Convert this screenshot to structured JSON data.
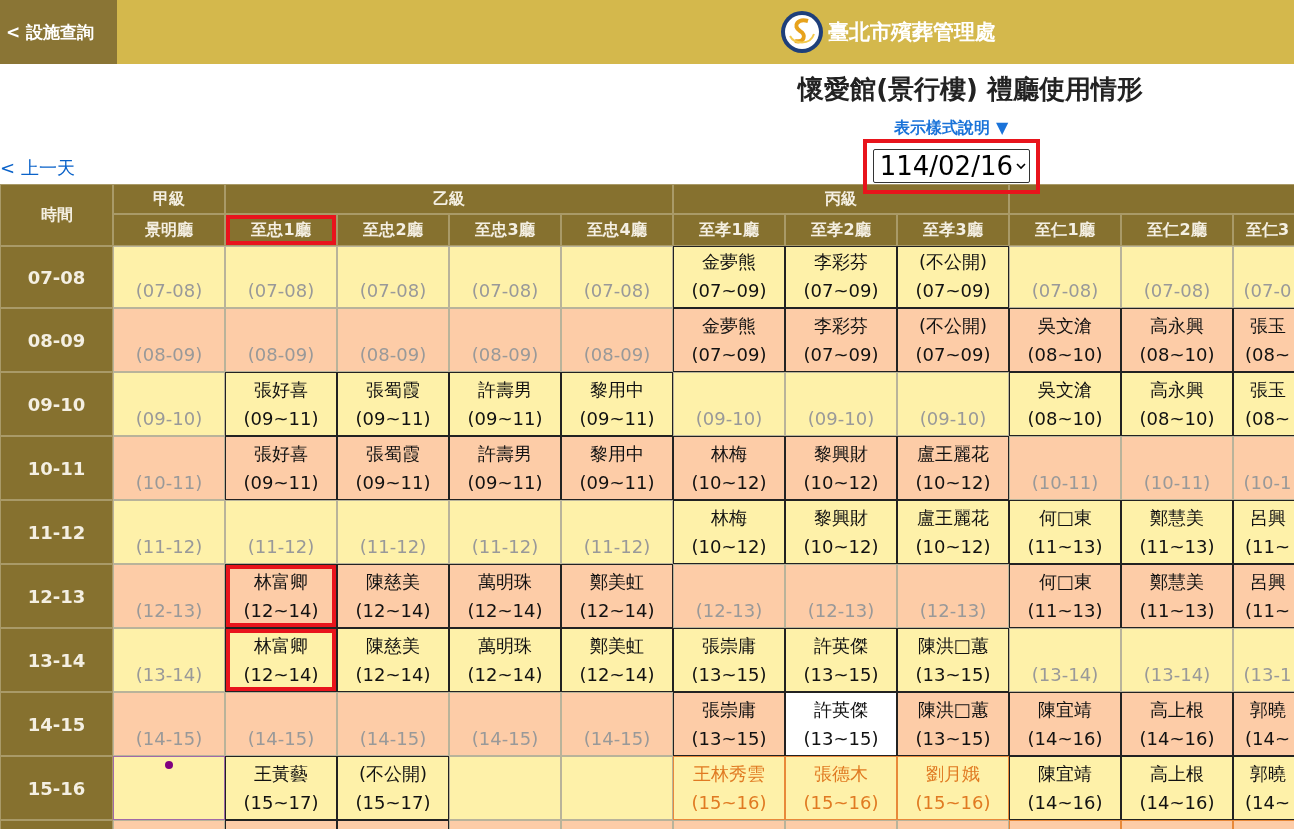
{
  "top_bar": {
    "back_button": "< 設施查詢",
    "agency": "臺北市殯葬管理處"
  },
  "title": "懷愛館(景行樓) 禮廳使用情形",
  "legend_link": "表示樣式說明 ▼",
  "date_select": {
    "value": "114/02/16",
    "highlighted": true
  },
  "prev_day_link": "< 上一天",
  "table": {
    "time_header": "時間",
    "groups": [
      {
        "label": "甲級",
        "columns": [
          {
            "label": "景明廳"
          }
        ]
      },
      {
        "label": "乙級",
        "columns": [
          {
            "label": "至忠1廳",
            "highlighted": true
          },
          {
            "label": "至忠2廳"
          },
          {
            "label": "至忠3廳"
          },
          {
            "label": "至忠4廳"
          }
        ]
      },
      {
        "label": "丙級",
        "columns": [
          {
            "label": "至孝1廳"
          },
          {
            "label": "至孝2廳"
          },
          {
            "label": "至孝3廳"
          }
        ]
      },
      {
        "columns": [
          {
            "label": "至仁1廳"
          },
          {
            "label": "至仁2廳"
          },
          {
            "label": "至仁3",
            "cut": true
          }
        ]
      }
    ],
    "rows": [
      {
        "time": "07-08",
        "cells": [
          {
            "kind": "free",
            "text": "(07-08)"
          },
          {
            "kind": "free",
            "text": "(07-08)"
          },
          {
            "kind": "free",
            "text": "(07-08)"
          },
          {
            "kind": "free",
            "text": "(07-08)"
          },
          {
            "kind": "free",
            "text": "(07-08)"
          },
          {
            "kind": "booked",
            "name": "金夢熊",
            "time": "(07~09)"
          },
          {
            "kind": "booked",
            "name": "李彩芬",
            "time": "(07~09)"
          },
          {
            "kind": "booked",
            "name": "(不公開)",
            "time": "(07~09)"
          },
          {
            "kind": "free",
            "text": "(07-08)"
          },
          {
            "kind": "free",
            "text": "(07-08)"
          },
          {
            "kind": "free",
            "text": "(07-0"
          }
        ]
      },
      {
        "time": "08-09",
        "cells": [
          {
            "kind": "free",
            "text": "(08-09)"
          },
          {
            "kind": "free",
            "text": "(08-09)"
          },
          {
            "kind": "free",
            "text": "(08-09)"
          },
          {
            "kind": "free",
            "text": "(08-09)"
          },
          {
            "kind": "free",
            "text": "(08-09)"
          },
          {
            "kind": "booked",
            "name": "金夢熊",
            "time": "(07~09)"
          },
          {
            "kind": "booked",
            "name": "李彩芬",
            "time": "(07~09)"
          },
          {
            "kind": "booked",
            "name": "(不公開)",
            "time": "(07~09)"
          },
          {
            "kind": "booked",
            "name": "吳文滄",
            "time": "(08~10)"
          },
          {
            "kind": "booked",
            "name": "高永興",
            "time": "(08~10)"
          },
          {
            "kind": "booked",
            "name": "張玉",
            "time": "(08~"
          }
        ]
      },
      {
        "time": "09-10",
        "cells": [
          {
            "kind": "free",
            "text": "(09-10)"
          },
          {
            "kind": "booked",
            "name": "張好喜",
            "time": "(09~11)"
          },
          {
            "kind": "booked",
            "name": "張蜀霞",
            "time": "(09~11)"
          },
          {
            "kind": "booked",
            "name": "許壽男",
            "time": "(09~11)"
          },
          {
            "kind": "booked",
            "name": "黎用中",
            "time": "(09~11)"
          },
          {
            "kind": "free",
            "text": "(09-10)"
          },
          {
            "kind": "free",
            "text": "(09-10)"
          },
          {
            "kind": "free",
            "text": "(09-10)"
          },
          {
            "kind": "booked",
            "name": "吳文滄",
            "time": "(08~10)"
          },
          {
            "kind": "booked",
            "name": "高永興",
            "time": "(08~10)"
          },
          {
            "kind": "booked",
            "name": "張玉",
            "time": "(08~"
          }
        ]
      },
      {
        "time": "10-11",
        "cells": [
          {
            "kind": "free",
            "text": "(10-11)"
          },
          {
            "kind": "booked",
            "name": "張好喜",
            "time": "(09~11)"
          },
          {
            "kind": "booked",
            "name": "張蜀霞",
            "time": "(09~11)"
          },
          {
            "kind": "booked",
            "name": "許壽男",
            "time": "(09~11)"
          },
          {
            "kind": "booked",
            "name": "黎用中",
            "time": "(09~11)"
          },
          {
            "kind": "booked",
            "name": "林梅",
            "time": "(10~12)"
          },
          {
            "kind": "booked",
            "name": "黎興財",
            "time": "(10~12)"
          },
          {
            "kind": "booked",
            "name": "盧王麗花",
            "time": "(10~12)"
          },
          {
            "kind": "free",
            "text": "(10-11)"
          },
          {
            "kind": "free",
            "text": "(10-11)"
          },
          {
            "kind": "free",
            "text": "(10-1"
          }
        ]
      },
      {
        "time": "11-12",
        "cells": [
          {
            "kind": "free",
            "text": "(11-12)"
          },
          {
            "kind": "free",
            "text": "(11-12)"
          },
          {
            "kind": "free",
            "text": "(11-12)"
          },
          {
            "kind": "free",
            "text": "(11-12)"
          },
          {
            "kind": "free",
            "text": "(11-12)"
          },
          {
            "kind": "booked",
            "name": "林梅",
            "time": "(10~12)"
          },
          {
            "kind": "booked",
            "name": "黎興財",
            "time": "(10~12)"
          },
          {
            "kind": "booked",
            "name": "盧王麗花",
            "time": "(10~12)"
          },
          {
            "kind": "booked",
            "name": "何□東",
            "time": "(11~13)"
          },
          {
            "kind": "booked",
            "name": "鄭慧美",
            "time": "(11~13)"
          },
          {
            "kind": "booked",
            "name": "呂興",
            "time": "(11~"
          }
        ]
      },
      {
        "time": "12-13",
        "cells": [
          {
            "kind": "free",
            "text": "(12-13)"
          },
          {
            "kind": "booked",
            "name": "林富卿",
            "time": "(12~14)",
            "highlighted": true
          },
          {
            "kind": "booked",
            "name": "陳慈美",
            "time": "(12~14)"
          },
          {
            "kind": "booked",
            "name": "萬明珠",
            "time": "(12~14)"
          },
          {
            "kind": "booked",
            "name": "鄭美虹",
            "time": "(12~14)"
          },
          {
            "kind": "free",
            "text": "(12-13)"
          },
          {
            "kind": "free",
            "text": "(12-13)"
          },
          {
            "kind": "free",
            "text": "(12-13)"
          },
          {
            "kind": "booked",
            "name": "何□東",
            "time": "(11~13)"
          },
          {
            "kind": "booked",
            "name": "鄭慧美",
            "time": "(11~13)"
          },
          {
            "kind": "booked",
            "name": "呂興",
            "time": "(11~"
          }
        ]
      },
      {
        "time": "13-14",
        "cells": [
          {
            "kind": "free",
            "text": "(13-14)"
          },
          {
            "kind": "booked",
            "name": "林富卿",
            "time": "(12~14)",
            "highlighted": true
          },
          {
            "kind": "booked",
            "name": "陳慈美",
            "time": "(12~14)"
          },
          {
            "kind": "booked",
            "name": "萬明珠",
            "time": "(12~14)"
          },
          {
            "kind": "booked",
            "name": "鄭美虹",
            "time": "(12~14)"
          },
          {
            "kind": "booked",
            "name": "張崇庸",
            "time": "(13~15)"
          },
          {
            "kind": "booked",
            "name": "許英傑",
            "time": "(13~15)"
          },
          {
            "kind": "booked",
            "name": "陳洪□蕙",
            "time": "(13~15)"
          },
          {
            "kind": "free",
            "text": "(13-14)"
          },
          {
            "kind": "free",
            "text": "(13-14)"
          },
          {
            "kind": "free",
            "text": "(13-1"
          }
        ]
      },
      {
        "time": "14-15",
        "cells": [
          {
            "kind": "free",
            "text": "(14-15)"
          },
          {
            "kind": "free",
            "text": "(14-15)"
          },
          {
            "kind": "free",
            "text": "(14-15)"
          },
          {
            "kind": "free",
            "text": "(14-15)"
          },
          {
            "kind": "free",
            "text": "(14-15)"
          },
          {
            "kind": "booked",
            "name": "張崇庸",
            "time": "(13~15)"
          },
          {
            "kind": "marked",
            "name": "許英傑",
            "time": "(13~15)"
          },
          {
            "kind": "booked",
            "name": "陳洪□蕙",
            "time": "(13~15)"
          },
          {
            "kind": "booked",
            "name": "陳宜靖",
            "time": "(14~16)"
          },
          {
            "kind": "booked",
            "name": "高上根",
            "time": "(14~16)"
          },
          {
            "kind": "booked",
            "name": "郭曉",
            "time": "(14~"
          }
        ]
      },
      {
        "time": "15-16",
        "cells": [
          {
            "kind": "dot",
            "color": "#800080"
          },
          {
            "kind": "booked",
            "name": "王黃藝",
            "time": "(15~17)"
          },
          {
            "kind": "booked",
            "name": "(不公開)",
            "time": "(15~17)"
          },
          {
            "kind": "empty"
          },
          {
            "kind": "empty"
          },
          {
            "kind": "tentative",
            "name": "王林秀雲",
            "time": "(15~16)"
          },
          {
            "kind": "tentative",
            "name": "張德木",
            "time": "(15~16)"
          },
          {
            "kind": "tentative",
            "name": "劉月娥",
            "time": "(15~16)"
          },
          {
            "kind": "booked",
            "name": "陳宜靖",
            "time": "(14~16)"
          },
          {
            "kind": "booked",
            "name": "高上根",
            "time": "(14~16)"
          },
          {
            "kind": "booked",
            "name": "郭曉",
            "time": "(14~"
          }
        ]
      },
      {
        "partial": true,
        "cells": [
          {
            "kind": "free"
          },
          {
            "kind": "booked"
          },
          {
            "kind": "booked"
          },
          {
            "kind": "free"
          },
          {
            "kind": "free"
          },
          {
            "kind": "free"
          },
          {
            "kind": "free"
          },
          {
            "kind": "free"
          },
          {
            "kind": "tentative"
          },
          {
            "kind": "tentative"
          },
          {
            "kind": "tentative"
          }
        ]
      }
    ]
  }
}
